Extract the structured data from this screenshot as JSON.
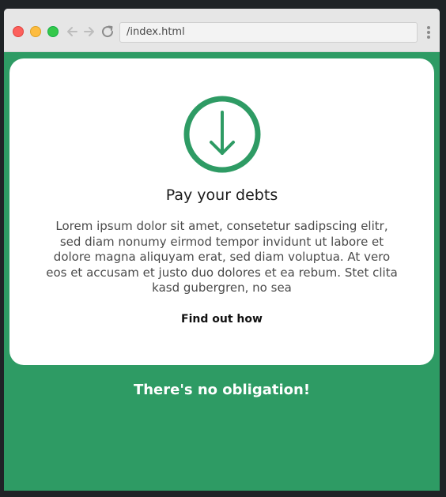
{
  "browser": {
    "url": "/index.html"
  },
  "card": {
    "icon": "download-arrow-circle-icon",
    "title": "Pay your debts",
    "body": "Lorem ipsum dolor sit amet, consetetur sadipscing elitr, sed diam nonumy eirmod tempor invidunt ut labore et dolore magna aliquyam erat, sed diam voluptua. At vero eos et accusam et justo duo dolores et ea rebum. Stet clita kasd gubergren, no sea",
    "link": "Find out how"
  },
  "footer": {
    "text": "There's no obligation!"
  },
  "colors": {
    "accent": "#2e9b64",
    "card": "#ffffff"
  }
}
